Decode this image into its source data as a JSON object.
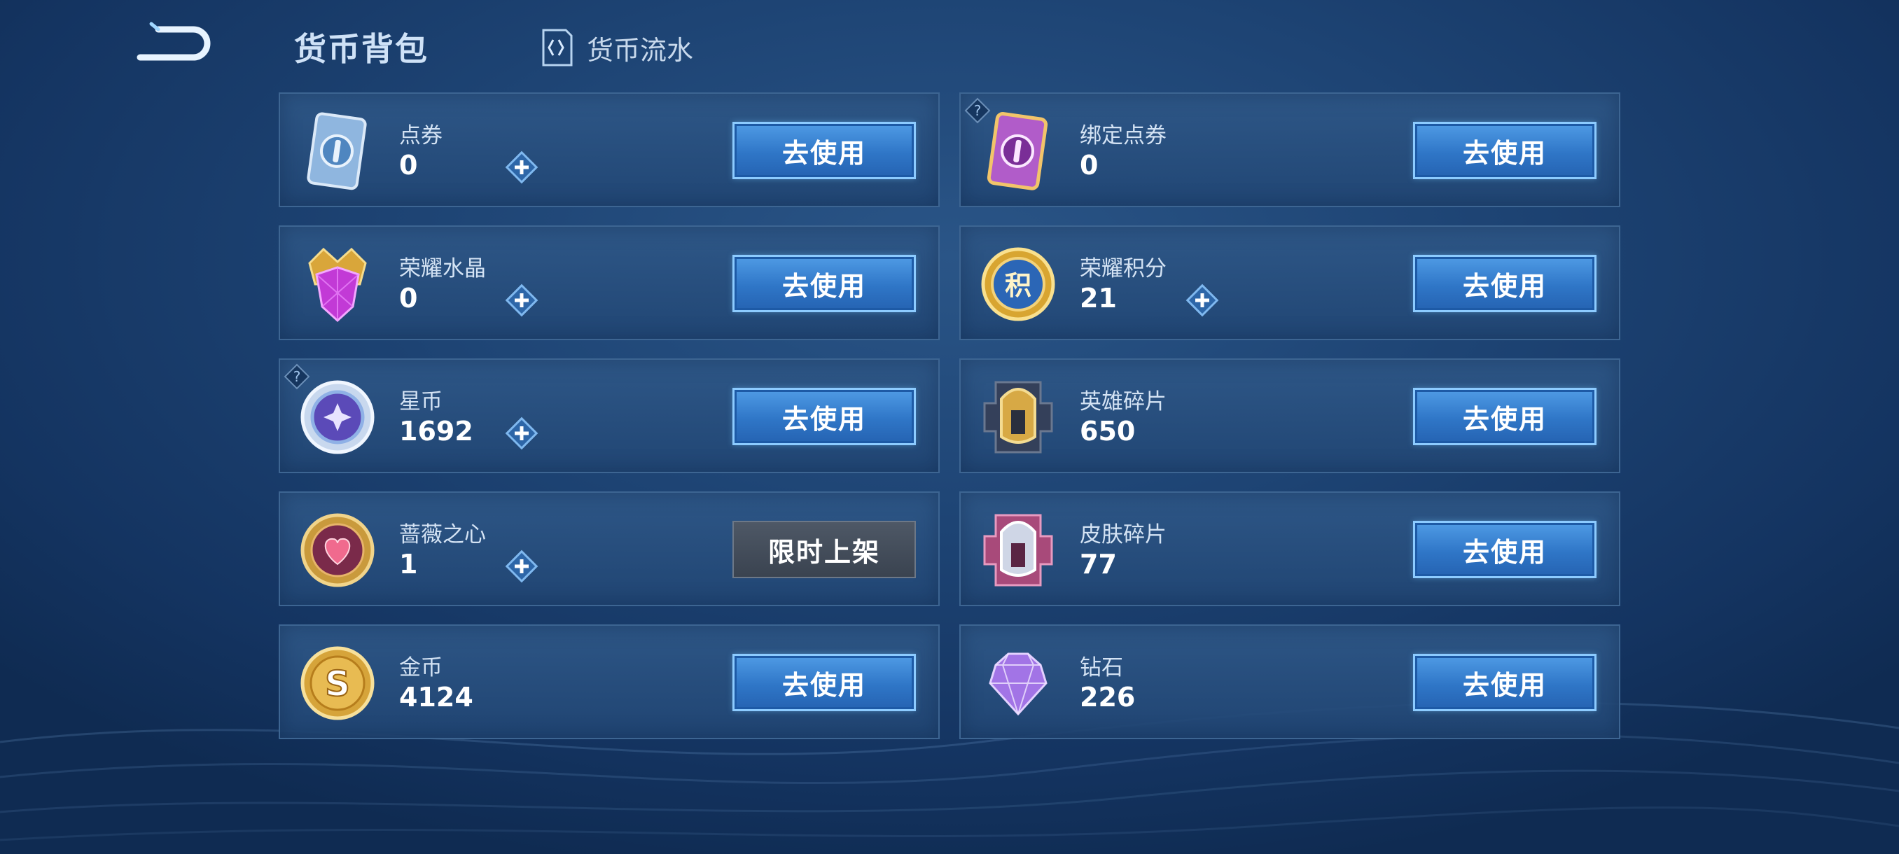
{
  "header": {
    "title": "货币背包",
    "flow_link_label": "货币流水"
  },
  "currencies": [
    {
      "name": "点券",
      "amount": "0",
      "action": "去使用",
      "icon": "coupon-ticket-icon",
      "has_plus": true,
      "has_help": false
    },
    {
      "name": "绑定点券",
      "amount": "0",
      "action": "去使用",
      "icon": "bound-coupon-ticket-icon",
      "has_plus": false,
      "has_help": true
    },
    {
      "name": "荣耀水晶",
      "amount": "0",
      "action": "去使用",
      "icon": "glory-crystal-icon",
      "has_plus": true,
      "has_help": false
    },
    {
      "name": "荣耀积分",
      "amount": "21",
      "action": "去使用",
      "icon": "glory-points-icon",
      "has_plus": true,
      "has_help": false
    },
    {
      "name": "星币",
      "amount": "1692",
      "action": "去使用",
      "icon": "star-coin-icon",
      "has_plus": true,
      "has_help": true
    },
    {
      "name": "英雄碎片",
      "amount": "650",
      "action": "去使用",
      "icon": "hero-fragment-icon",
      "has_plus": false,
      "has_help": false
    },
    {
      "name": "蔷薇之心",
      "amount": "1",
      "action": "限时上架",
      "icon": "rose-heart-icon",
      "has_plus": true,
      "has_help": false
    },
    {
      "name": "皮肤碎片",
      "amount": "77",
      "action": "去使用",
      "icon": "skin-fragment-icon",
      "has_plus": false,
      "has_help": false
    },
    {
      "name": "金币",
      "amount": "4124",
      "action": "去使用",
      "icon": "gold-coin-icon",
      "has_plus": false,
      "has_help": false
    },
    {
      "name": "钻石",
      "amount": "226",
      "action": "去使用",
      "icon": "diamond-icon",
      "has_plus": false,
      "has_help": false
    }
  ],
  "colors": {
    "accent_button": "#3a86d6",
    "disabled_button": "#434c59",
    "card_background": "#27507f",
    "card_border": "#3d6592"
  }
}
